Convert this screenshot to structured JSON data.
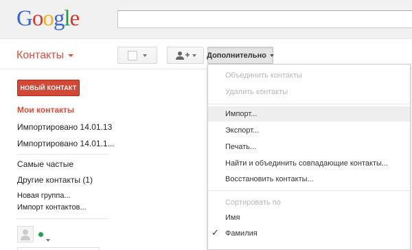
{
  "header": {
    "logo": [
      "G",
      "o",
      "o",
      "g",
      "l",
      "e"
    ],
    "logo_colors": [
      "#3a67d8",
      "#d8382a",
      "#f2b01e",
      "#3a67d8",
      "#219a3e",
      "#d8382a"
    ],
    "search_value": ""
  },
  "app": {
    "title": "Контакты",
    "accent_color": "#dd4b39"
  },
  "toolbar": {
    "more_label": "Дополнительно"
  },
  "sidebar": {
    "new_contact": "НОВЫЙ КОНТАКТ",
    "my_contacts": "Мои контакты",
    "imported_1": "Импортировано 14.01.13",
    "imported_2": "Импортировано 14.01.1...",
    "frequent": "Самые частые",
    "other": "Другие контакты (1)",
    "new_group": "Новая группа...",
    "import_contacts": "Импорт контактов..."
  },
  "menu": {
    "merge": "Объединить контакты",
    "delete": "Удалить контакты",
    "import": "Импорт...",
    "export": "Экспорт...",
    "print": "Печать...",
    "find_merge": "Найти и объединить совпадающие контакты...",
    "restore": "Восстановить контакты...",
    "sort_by": "Сортировать по",
    "sort_name": "Имя",
    "sort_surname": "Фамилия",
    "checkmark": "✓"
  },
  "edge_fragment": "."
}
